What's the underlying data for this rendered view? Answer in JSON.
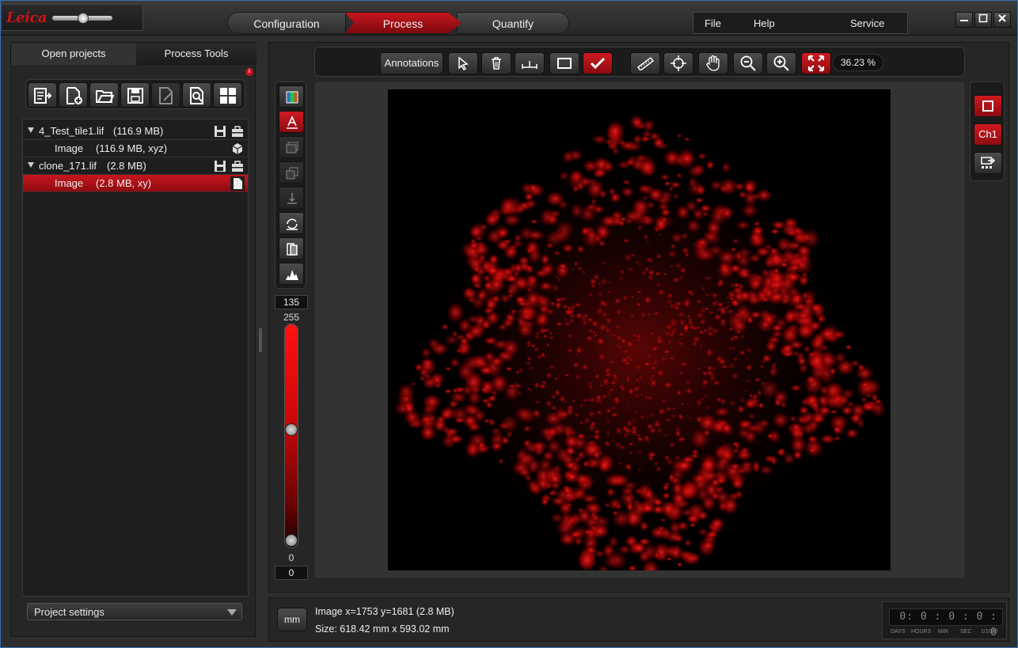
{
  "app": {
    "logo": "Leica",
    "modes": [
      "Configuration",
      "Process",
      "Quantify"
    ],
    "active_mode": "Process",
    "menu": [
      "File",
      "Help",
      "Service"
    ],
    "window_buttons": [
      "minimize",
      "maximize",
      "close"
    ]
  },
  "left_panel": {
    "tabs": [
      "Open projects",
      "Process Tools"
    ],
    "active_tab": "Open projects",
    "toolbar_icons": [
      "export-list-icon",
      "new-file-icon",
      "open-folder-icon",
      "save-icon",
      "edit-file-icon",
      "find-file-icon",
      "grid-layout-icon"
    ],
    "tree": [
      {
        "label": "4_Test_tile1.lif",
        "size": "(116.9 MB)",
        "level": 0,
        "icons": [
          "save-icon",
          "toolbox-icon"
        ]
      },
      {
        "label": "Image",
        "size": "(116.9 MB, xyz)",
        "level": 1,
        "icons": [
          "cube-icon"
        ]
      },
      {
        "label": "clone_171.lif",
        "size": "(2.8 MB)",
        "level": 0,
        "icons": [
          "save-icon",
          "toolbox-icon"
        ]
      },
      {
        "label": "Image",
        "size": "(2.8 MB, xy)",
        "level": 1,
        "selected": true,
        "icons": [
          "document-icon"
        ]
      }
    ],
    "project_settings": "Project settings"
  },
  "viewer_toolbar": {
    "annotations": "Annotations",
    "icons": [
      "pointer-icon",
      "trash-icon",
      "measure-line-icon",
      "rectangle-icon",
      "checkmark-icon",
      "ruler-icon",
      "crosshair-icon",
      "pan-hand-icon",
      "zoom-out-icon",
      "zoom-in-icon",
      "fit-to-screen-icon"
    ],
    "zoom": "36.23 %"
  },
  "left_tools": {
    "icons": [
      "color-lut-icon",
      "text-overlay-icon",
      "stack-icon",
      "layers-icon",
      "z-step-icon",
      "rotate-icon",
      "split-view-icon",
      "histogram-icon"
    ]
  },
  "lut": {
    "max_value": "135",
    "max_label": "255",
    "min_label": "0",
    "min_value": "0",
    "channel_color": "#ff0000",
    "upper_knob_fraction": 0.53,
    "lower_knob_fraction": 0.0
  },
  "right_tools": {
    "channel": "Ch1",
    "icons": [
      "stop-square-icon",
      "channel-export-icon"
    ]
  },
  "status": {
    "unit_button": "mm",
    "position": "Image x=1753 y=1681  (2.8 MB)",
    "size": "Size: 618.42 mm x 593.02 mm",
    "timer": "0: 0 : 0 : 0 : 0",
    "timer_labels": [
      "DAYS",
      "HOURS",
      "MIN",
      "SEC",
      "1/1000"
    ]
  }
}
